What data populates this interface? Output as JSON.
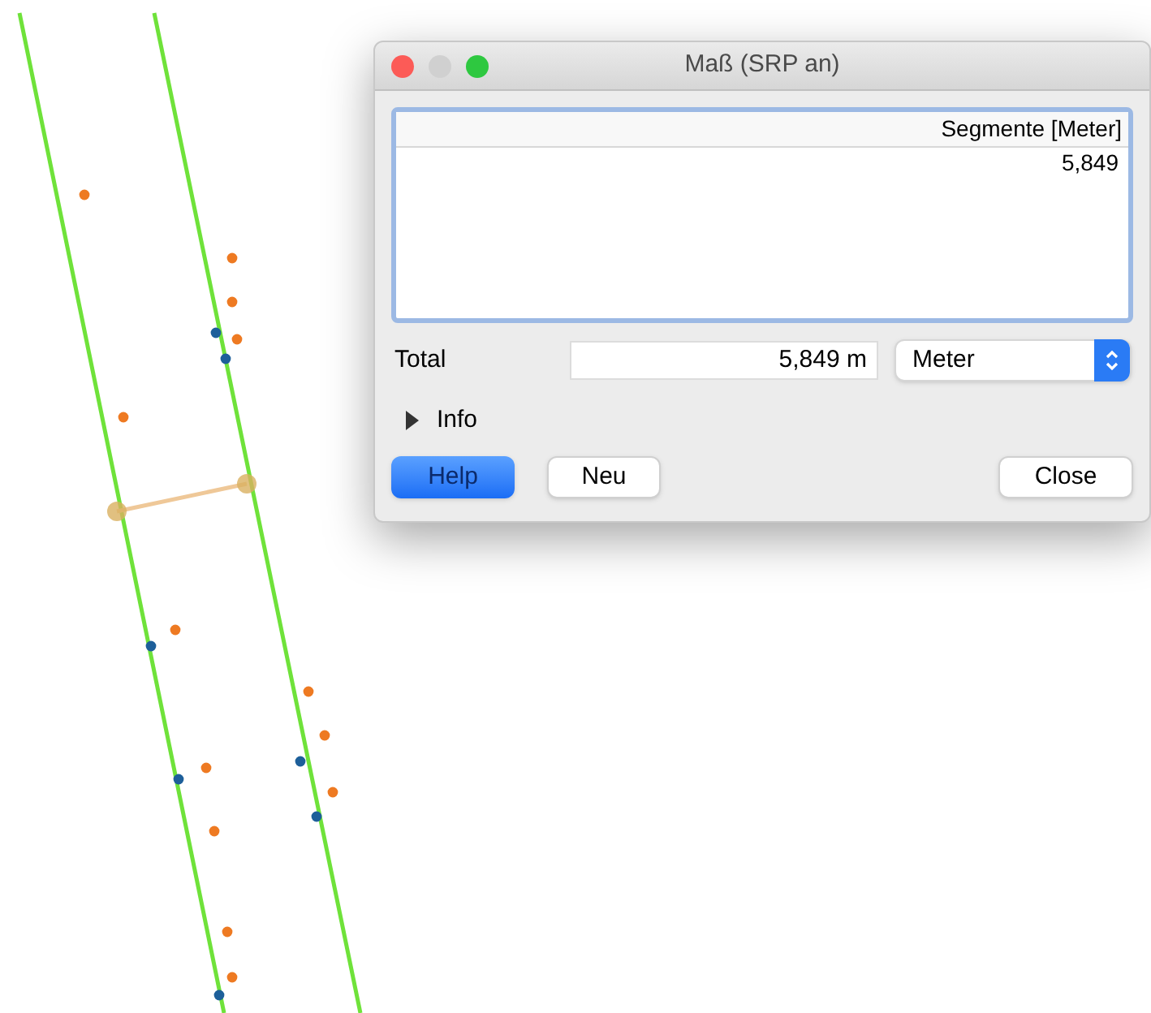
{
  "window": {
    "title": "Maß (SRP an)"
  },
  "list": {
    "column": "Segmente [Meter]",
    "rows": [
      "5,849"
    ]
  },
  "total": {
    "label": "Total",
    "value": "5,849 m",
    "unit": "Meter"
  },
  "info": {
    "label": "Info",
    "expanded": false
  },
  "buttons": [
    {
      "label": "Help",
      "default": true
    },
    {
      "label": "Neu",
      "default": false
    },
    {
      "label": "Close",
      "default": false
    }
  ]
}
